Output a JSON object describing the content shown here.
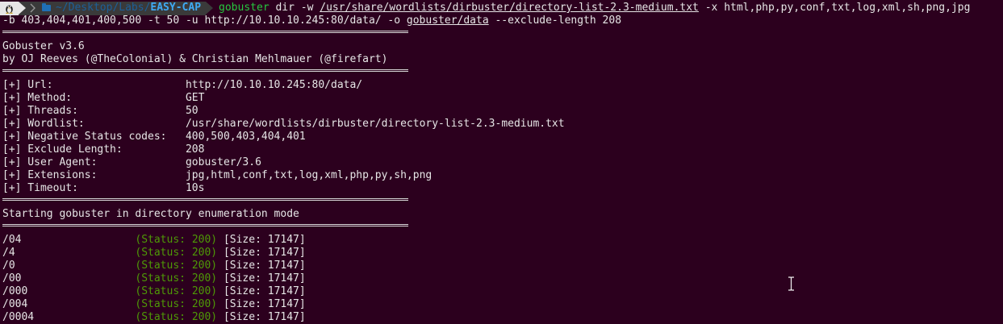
{
  "prompt": {
    "os_icon": "linux-penguin-icon",
    "sep_icon": "chevron-right-icon",
    "dir_icon": "folder-icon",
    "dir_path": "~/Desktop/Labs/",
    "dir_last": "EASY-CAP",
    "command_name": "gobuster",
    "cmd_part1": " dir -w ",
    "wordlist_path": "/usr/share/wordlists/dirbuster/directory-list-2.3-medium.txt",
    "cmd_part2": " -x html,php,py,conf,txt,log,xml,sh,png,jpg",
    "cmd_line2_part1": "-b 403,404,401,400,500 -t 50 -u http://10.10.10.245:80/data/ -o ",
    "output_path": "gobuster/data",
    "cmd_line2_part2": " --exclude-length 208"
  },
  "banner": {
    "title": "Gobuster v3.6",
    "authors": "by OJ Reeves (@TheColonial) & Christian Mehlmauer (@firefart)"
  },
  "config": [
    {
      "key": "[+] Url:                     ",
      "value": "http://10.10.10.245:80/data/"
    },
    {
      "key": "[+] Method:                  ",
      "value": "GET"
    },
    {
      "key": "[+] Threads:                 ",
      "value": "50"
    },
    {
      "key": "[+] Wordlist:                ",
      "value": "/usr/share/wordlists/dirbuster/directory-list-2.3-medium.txt"
    },
    {
      "key": "[+] Negative Status codes:   ",
      "value": "400,500,403,404,401"
    },
    {
      "key": "[+] Exclude Length:          ",
      "value": "208"
    },
    {
      "key": "[+] User Agent:              ",
      "value": "gobuster/3.6"
    },
    {
      "key": "[+] Extensions:              ",
      "value": "jpg,html,conf,txt,log,xml,php,py,sh,png"
    },
    {
      "key": "[+] Timeout:                 ",
      "value": "10s"
    }
  ],
  "mode_message": "Starting gobuster in directory enumeration mode",
  "results": [
    {
      "path": "/04                  ",
      "status": "(Status: 200)",
      "size": " [Size: 17147]"
    },
    {
      "path": "/4                   ",
      "status": "(Status: 200)",
      "size": " [Size: 17147]"
    },
    {
      "path": "/0                   ",
      "status": "(Status: 200)",
      "size": " [Size: 17147]"
    },
    {
      "path": "/00                  ",
      "status": "(Status: 200)",
      "size": " [Size: 17147]"
    },
    {
      "path": "/000                 ",
      "status": "(Status: 200)",
      "size": " [Size: 17147]"
    },
    {
      "path": "/004                 ",
      "status": "(Status: 200)",
      "size": " [Size: 17147]"
    },
    {
      "path": "/0004                ",
      "status": "(Status: 200)",
      "size": " [Size: 17147]"
    }
  ],
  "colors": {
    "background": "#2c001e",
    "foreground": "#e6e6e6",
    "command": "#27c93f",
    "status": "#4e9a06",
    "directory": "#3fa9f5"
  }
}
